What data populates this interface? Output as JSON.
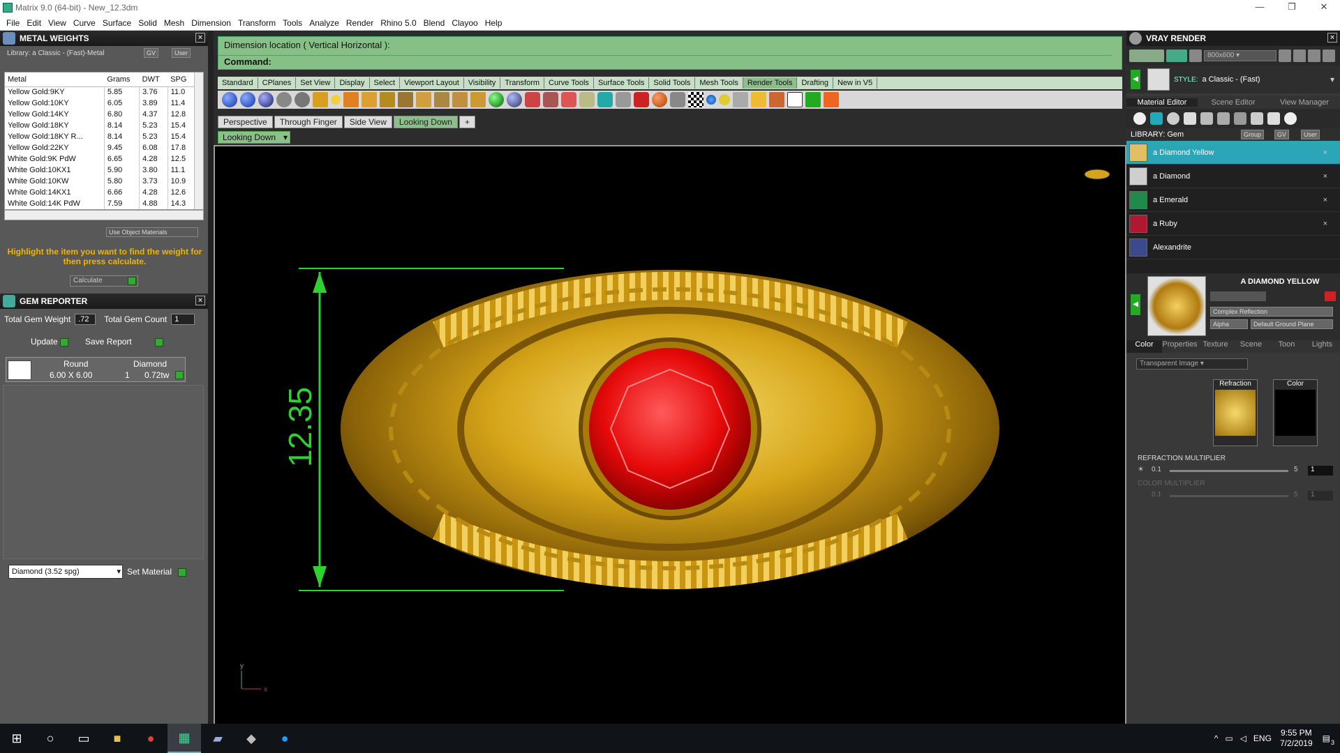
{
  "window": {
    "title": "Matrix 9.0 (64-bit) - New_12.3dm",
    "minimize": "—",
    "maximize": "❐",
    "close": "✕"
  },
  "menu": [
    "File",
    "Edit",
    "View",
    "Curve",
    "Surface",
    "Solid",
    "Mesh",
    "Dimension",
    "Transform",
    "Tools",
    "Analyze",
    "Render",
    "Rhino 5.0",
    "Blend",
    "Clayoo",
    "Help"
  ],
  "metal_weights": {
    "title": "METAL WEIGHTS",
    "library": "Library: a Classic - (Fast)-Metal",
    "gv": "GV",
    "user": "User",
    "columns": [
      "Metal",
      "Grams",
      "DWT",
      "SPG"
    ],
    "rows": [
      [
        "Yellow Gold:9KY",
        "5.85",
        "3.76",
        "11.0"
      ],
      [
        "Yellow Gold:10KY",
        "6.05",
        "3.89",
        "11.4"
      ],
      [
        "Yellow Gold:14KY",
        "6.80",
        "4.37",
        "12.8"
      ],
      [
        "Yellow Gold:18KY",
        "8.14",
        "5.23",
        "15.4"
      ],
      [
        "Yellow Gold:18KY R...",
        "8.14",
        "5.23",
        "15.4"
      ],
      [
        "Yellow Gold:22KY",
        "9.45",
        "6.08",
        "17.8"
      ],
      [
        "White Gold:9K PdW",
        "6.65",
        "4.28",
        "12.5"
      ],
      [
        "White Gold:10KX1",
        "5.90",
        "3.80",
        "11.1"
      ],
      [
        "White Gold:10KW",
        "5.80",
        "3.73",
        "10.9"
      ],
      [
        "White Gold:14KX1",
        "6.66",
        "4.28",
        "12.6"
      ],
      [
        "White Gold:14K PdW",
        "7.59",
        "4.88",
        "14.3"
      ]
    ],
    "use_object_materials": "Use Object Materials",
    "hint": "Highlight the item you want to find the weight for then press calculate.",
    "calculate": "Calculate"
  },
  "gem_reporter": {
    "title": "GEM REPORTER",
    "total_weight_label": "Total Gem Weight",
    "total_weight": ".72",
    "total_count_label": "Total Gem Count",
    "total_count": "1",
    "update": "Update",
    "save_report": "Save Report",
    "shape": "Round",
    "type": "Diamond",
    "size": "6.00 X 6.00",
    "qty": "1",
    "weight": "0.72tw",
    "material_select": "Diamond    (3.52 spg)",
    "set_material": "Set Material"
  },
  "command": {
    "prompt": "Dimension location ( Vertical  Horizontal ):",
    "label": "Command:"
  },
  "toolbar_tabs": [
    "Standard",
    "CPlanes",
    "Set View",
    "Display",
    "Select",
    "Viewport Layout",
    "Visibility",
    "Transform",
    "Curve Tools",
    "Surface Tools",
    "Solid Tools",
    "Mesh Tools",
    "Render Tools",
    "Drafting",
    "New in V5"
  ],
  "active_toolbar_tab": "Render Tools",
  "viewport_tabs": [
    "Perspective",
    "Through Finger",
    "Side View",
    "Looking Down"
  ],
  "active_viewport": "Looking Down",
  "viewport_label": "Looking Down",
  "dimension_value": "12.35",
  "axis": {
    "x": "x",
    "y": "y"
  },
  "vray": {
    "title": "VRAY RENDER",
    "resolution": "800x600",
    "style_label": "STYLE:",
    "style_value": "a Classic - (Fast)",
    "tabs": [
      "Material Editor",
      "Scene Editor",
      "View Manager"
    ],
    "library": "LIBRARY: Gem",
    "group": "Group",
    "gv": "GV",
    "user": "User",
    "gems": [
      {
        "name": "a Diamond Yellow",
        "color": "#e0c060"
      },
      {
        "name": "a Diamond",
        "color": "#cfcfcf"
      },
      {
        "name": "a Emerald",
        "color": "#1f8a4a"
      },
      {
        "name": "a Ruby",
        "color": "#b01830"
      },
      {
        "name": "Alexandrite",
        "color": "#3a4a8a"
      }
    ],
    "selected_material": "A DIAMOND YELLOW",
    "complex_reflection": "Complex Reflection",
    "alpha": "Alpha",
    "ground_plane": "Default Ground Plane",
    "prop_tabs": [
      "Color",
      "Properties",
      "Texture",
      "Scene",
      "Toon",
      "Lights"
    ],
    "transparent_image": "Transparent Image",
    "refraction": "Refraction",
    "color": "Color",
    "refraction_multiplier": "REFRACTION MULTIPLIER",
    "color_multiplier": "COLOR MULTIPLIER",
    "min": "0.1",
    "max": "5",
    "value": "1"
  },
  "tray": {
    "lang": "ENG",
    "time": "9:55 PM",
    "date": "7/2/2019",
    "notifications": "3"
  }
}
